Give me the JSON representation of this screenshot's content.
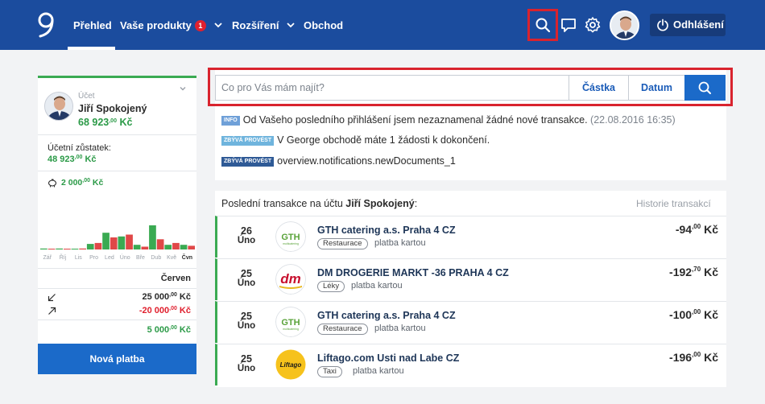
{
  "header": {
    "nav": [
      {
        "label": "Přehled"
      },
      {
        "label": "Vaše produkty",
        "badge": "1"
      },
      {
        "label": "Rozšíření"
      },
      {
        "label": "Obchod"
      }
    ],
    "logout_label": "Odhlášení"
  },
  "account": {
    "label": "Účet",
    "name": "Jiří Spokojený",
    "amount_main": "68 923",
    "amount_dec": ",00",
    "amount_cur": " Kč",
    "balance_label": "Účetní zůstatek:",
    "balance_main": "48 923",
    "balance_dec": ",00",
    "balance_cur": " Kč",
    "saving_main": "2 000",
    "saving_dec": ",00",
    "saving_cur": " Kč",
    "months": [
      "Zář",
      "Říj",
      "Lis",
      "Pro",
      "Led",
      "Úno",
      "Bře",
      "Dub",
      "Kvě",
      "Čvn"
    ],
    "current_month": "Červen",
    "income_main": "25 000",
    "income_dec": ",00",
    "income_cur": " Kč",
    "expense_main": "-20 000",
    "expense_dec": ",00",
    "expense_cur": " Kč",
    "net_main": "5 000",
    "net_dec": ",00",
    "net_cur": " Kč",
    "new_payment_label": "Nová platba"
  },
  "chart_data": {
    "type": "bar",
    "categories": [
      "Zář",
      "Říj",
      "Lis",
      "Pro",
      "Led",
      "Úno",
      "Bře",
      "Dub",
      "Kvě",
      "Čvn"
    ],
    "series": [
      {
        "color": "#3aaa52",
        "values": [
          1,
          1,
          0,
          6,
          18,
          14,
          5,
          26,
          5,
          5
        ]
      },
      {
        "color": "#e04848",
        "values": [
          0,
          0,
          1,
          7,
          13,
          16,
          3,
          11,
          7,
          4
        ]
      }
    ]
  },
  "search": {
    "placeholder": "Co pro Vás mám najít?",
    "amount_label": "Částka",
    "date_label": "Datum"
  },
  "notifications": [
    {
      "tag": "INFO",
      "tag_color": "#6fa0d8",
      "text": "Od Vašeho posledního přihlášení jsem nezaznamenal žádné nové transakce.",
      "muted": " (22.08.2016 16:35)"
    },
    {
      "tag": "ZBÝVÁ PROVÉST",
      "tag_color": "#6fb4dd",
      "text": "V George obchodě máte 1 žádosti k dokončení.",
      "muted": ""
    },
    {
      "tag": "ZBÝVÁ PROVÉST",
      "tag_color": "#2f5a96",
      "text": "overview.notifications.newDocuments_1",
      "muted": ""
    }
  ],
  "transactions": {
    "heading_prefix": "Poslední transakce na účtu ",
    "heading_name": "Jiří Spokojený",
    "heading_suffix": ":",
    "history_label": "Historie transakcí",
    "rows": [
      {
        "day": "26",
        "month": "Úno",
        "name": "GTH catering a.s. Praha 4 CZ",
        "category": "Restaurace",
        "method": "platba kartou",
        "amount_main": "-94",
        "amount_dec": ",00",
        "amount_cur": " Kč",
        "logo_text": "GTH"
      },
      {
        "day": "25",
        "month": "Úno",
        "name": "DM DROGERIE MARKT -36 PRAHA 4 CZ",
        "category": "Léky",
        "method": "platba kartou",
        "amount_main": "-192",
        "amount_dec": ",70",
        "amount_cur": " Kč",
        "logo_text": "dm"
      },
      {
        "day": "25",
        "month": "Úno",
        "name": "GTH catering a.s. Praha 4 CZ",
        "category": "Restaurace",
        "method": "platba kartou",
        "amount_main": "-100",
        "amount_dec": ",00",
        "amount_cur": " Kč",
        "logo_text": "GTH"
      },
      {
        "day": "25",
        "month": "Úno",
        "name": "Liftago.com Usti nad Labe CZ",
        "category": "Taxi",
        "method": "platba kartou",
        "amount_main": "-196",
        "amount_dec": ",00",
        "amount_cur": " Kč",
        "logo_text": "Liftago"
      }
    ]
  }
}
